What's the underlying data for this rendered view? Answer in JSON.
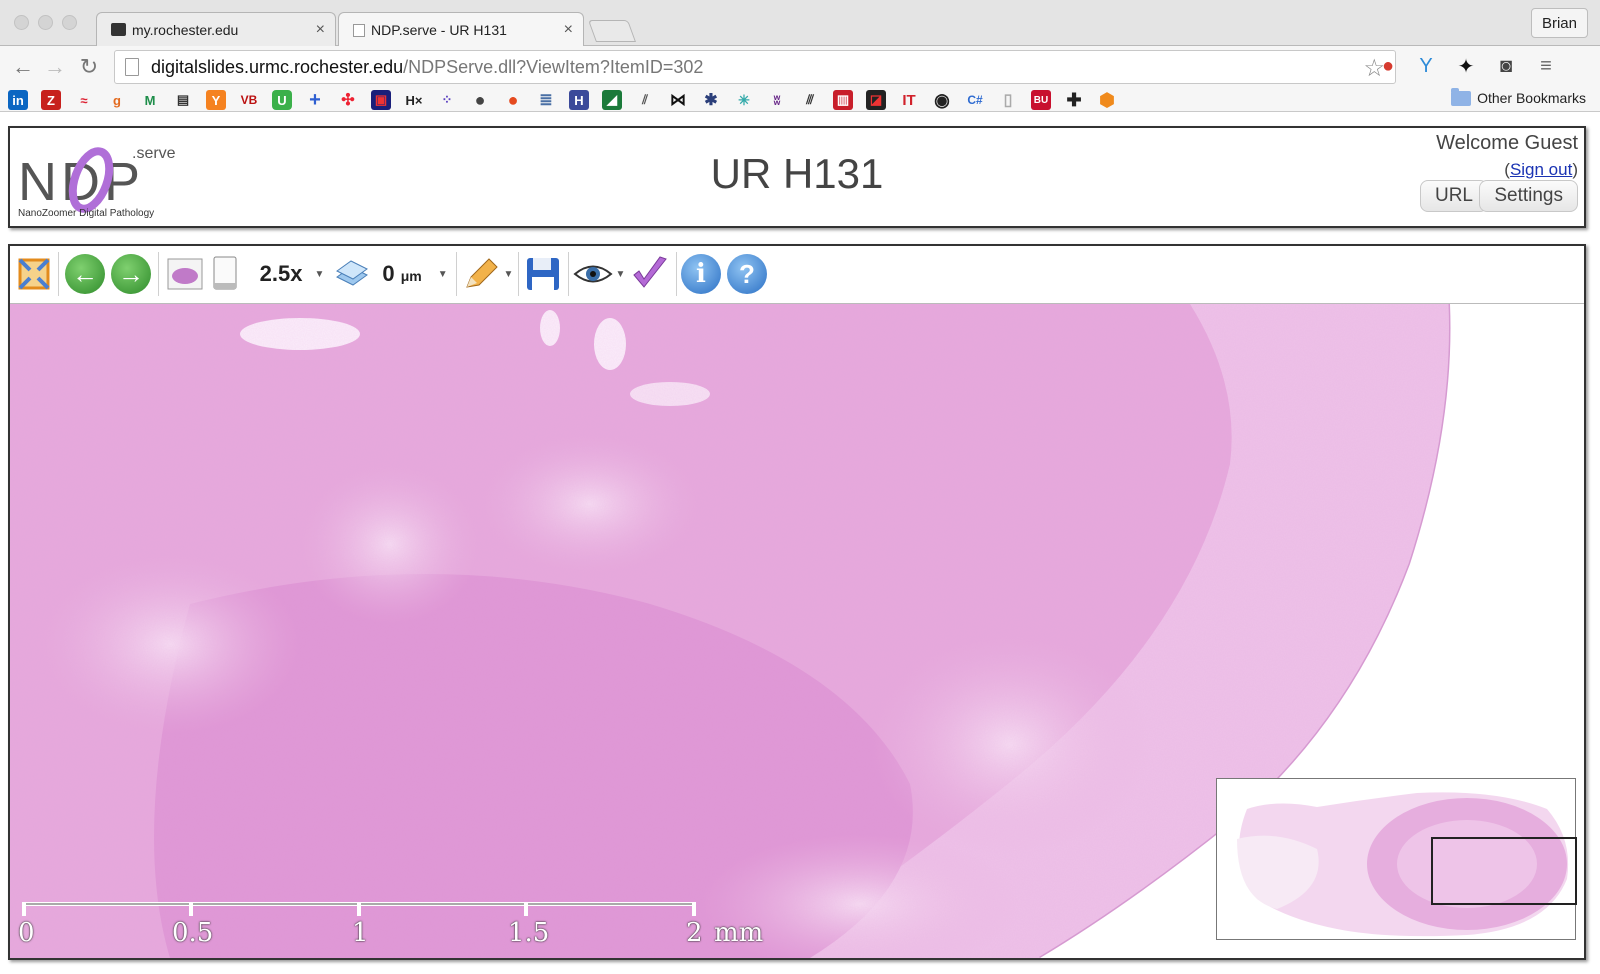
{
  "browser": {
    "tabs": [
      {
        "title": "my.rochester.edu",
        "active": false
      },
      {
        "title": "NDP.serve - UR H131",
        "active": true
      }
    ],
    "profile": "Brian",
    "url_host": "digitalslides.urmc.rochester.edu",
    "url_path": "/NDPServe.dll?ViewItem?ItemID=302",
    "other_bookmarks": "Other Bookmarks",
    "bookmark_icons": [
      "in",
      "Z",
      "g",
      "Y",
      "VB",
      "U",
      "H×",
      "C#",
      "BU"
    ]
  },
  "header": {
    "logo_main": "NDP",
    "logo_sup": ".serve",
    "logo_sub": "NanoZoomer Digital Pathology",
    "slide_title": "UR H131",
    "welcome": "Welcome Guest",
    "signout_open": "(",
    "signout_label": "Sign out",
    "signout_close": ")",
    "url_button": "URL",
    "settings_button": "Settings"
  },
  "viewer": {
    "zoom": "2.5x",
    "focus_value": "0",
    "focus_unit": "μm",
    "scale_labels": [
      "0",
      "0.5",
      "1",
      "1.5",
      "2"
    ],
    "scale_unit": "mm"
  },
  "colors": {
    "tissue_pink": "#e7a6dc",
    "tissue_light": "#f2cdee",
    "accent_green": "#3e9a3a",
    "accent_blue": "#2f7fd1"
  }
}
